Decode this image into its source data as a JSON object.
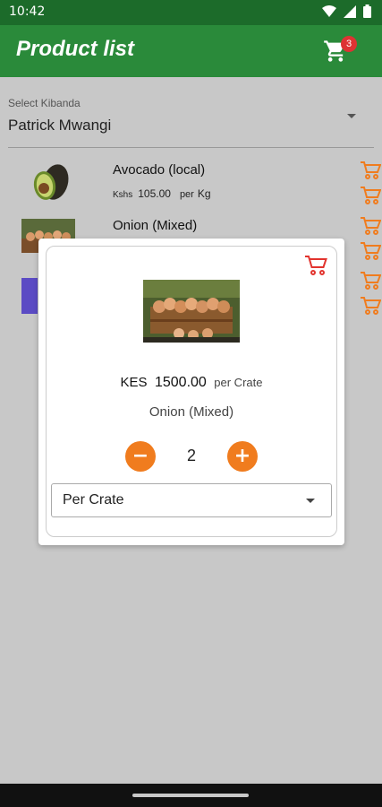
{
  "status_bar": {
    "time": "10:42"
  },
  "app_bar": {
    "title": "Product list",
    "cart_count": "3",
    "cart_icon": "cart-icon"
  },
  "kibanda": {
    "label": "Select Kibanda",
    "value": "Patrick Mwangi"
  },
  "products": [
    {
      "name": "Avocado (local)",
      "currency": "Kshs",
      "price": "105.00",
      "per": "per",
      "unit": "Kg"
    },
    {
      "name": "Onion (Mixed)"
    }
  ],
  "dialog": {
    "currency": "KES",
    "price": "1500.00",
    "per_unit": "per Crate",
    "product_name": "Onion (Mixed)",
    "quantity": "2",
    "minus_symbol": "−",
    "plus_symbol": "+",
    "unit_option": "Per Crate"
  },
  "colors": {
    "app_bar": "#2a8a3a",
    "status_bar": "#1c6b2a",
    "accent_orange": "#f07c1e",
    "cart_red": "#e2342e",
    "badge_red": "#d33333"
  }
}
